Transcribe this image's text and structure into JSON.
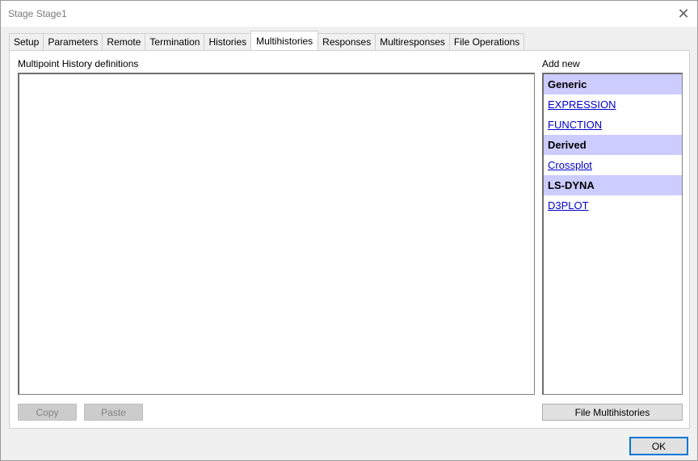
{
  "window": {
    "title": "Stage Stage1",
    "close_glyph": "✕"
  },
  "tabs": [
    {
      "label": "Setup",
      "active": false
    },
    {
      "label": "Parameters",
      "active": false
    },
    {
      "label": "Remote",
      "active": false
    },
    {
      "label": "Termination",
      "active": false
    },
    {
      "label": "Histories",
      "active": false
    },
    {
      "label": "Multihistories",
      "active": true
    },
    {
      "label": "Responses",
      "active": false
    },
    {
      "label": "Multiresponses",
      "active": false
    },
    {
      "label": "File Operations",
      "active": false
    }
  ],
  "main": {
    "list_label": "Multipoint History definitions",
    "add_label": "Add new",
    "groups": [
      {
        "header": "Generic",
        "links": [
          "EXPRESSION",
          "FUNCTION"
        ]
      },
      {
        "header": "Derived",
        "links": [
          "Crossplot"
        ]
      },
      {
        "header": "LS-DYNA",
        "links": [
          "D3PLOT"
        ]
      }
    ],
    "copy_label": "Copy",
    "paste_label": "Paste",
    "file_label": "File Multihistories"
  },
  "footer": {
    "ok_label": "OK"
  },
  "colors": {
    "group_header_bg": "#ccccff",
    "link": "#0000cc",
    "ok_border": "#0078d7"
  }
}
